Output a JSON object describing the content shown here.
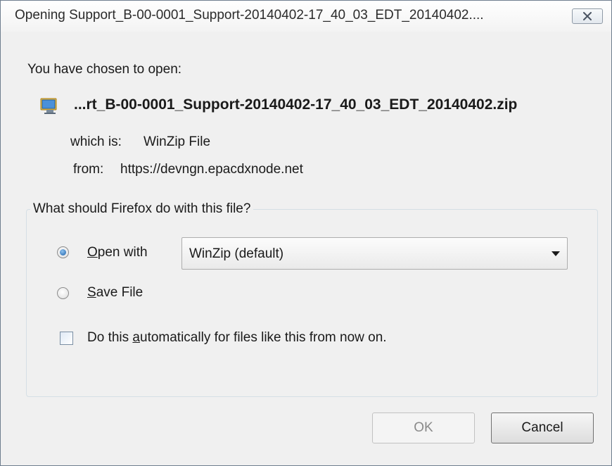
{
  "window": {
    "title": "Opening Support_B-00-0001_Support-20140402-17_40_03_EDT_20140402....",
    "close_icon": "close-x-icon"
  },
  "content": {
    "intro": "You have chosen to open:",
    "file_icon": "winzip-file-icon",
    "filename": "...rt_B-00-0001_Support-20140402-17_40_03_EDT_20140402.zip",
    "which_is_label": "which is:",
    "which_is_value": "WinZip File",
    "from_label": "from:",
    "from_value": "https://devngn.epacdxnode.net"
  },
  "action_group": {
    "legend": "What should Firefox do with this file?",
    "open_with": {
      "access_key": "O",
      "label_rest": "pen with",
      "selected": true
    },
    "open_with_app": "WinZip (default)",
    "save_file": {
      "access_key": "S",
      "label_rest": "ave File",
      "selected": false
    },
    "auto": {
      "label_before": "Do this ",
      "access_key": "a",
      "label_after": "utomatically for files like this from now on.",
      "checked": false
    }
  },
  "buttons": {
    "ok_label": "OK",
    "ok_enabled": false,
    "cancel_label": "Cancel"
  },
  "colors": {
    "accent": "#1b5fa8",
    "dialog_bg": "#f0f0f0"
  }
}
